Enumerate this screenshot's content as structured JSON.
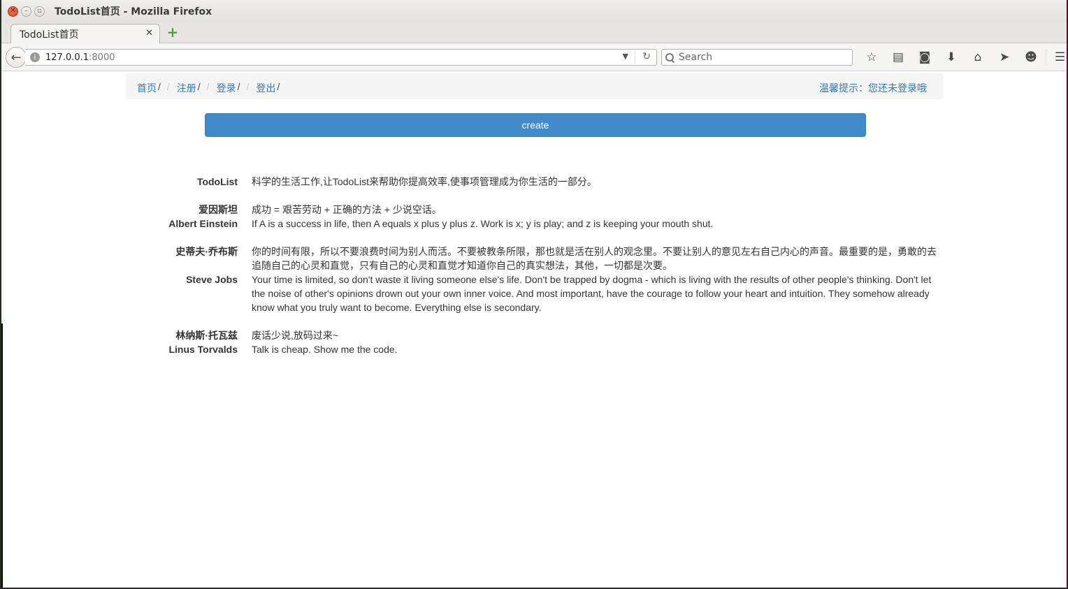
{
  "window": {
    "title": "TodoList首页 - Mozilla Firefox"
  },
  "tab": {
    "title": "TodoList首页",
    "close_glyph": "✕",
    "new_tab_glyph": "+"
  },
  "toolbar": {
    "url_host": "127.0.0.1",
    "url_port": ":8000",
    "search_placeholder": "Search",
    "icons": [
      "bookmark-star-icon",
      "reading-list-icon",
      "pocket-icon",
      "download-icon",
      "home-icon",
      "share-icon",
      "chat-icon",
      "hamburger-menu-icon"
    ]
  },
  "breadcrumb": {
    "items": [
      {
        "label": "首页",
        "slash": "/"
      },
      {
        "label": "注册",
        "slash": "/"
      },
      {
        "label": "登录",
        "slash": "/"
      },
      {
        "label": "登出",
        "slash": "/"
      }
    ],
    "separator": "/",
    "hint": "温馨提示：您还未登录哦"
  },
  "create_button": {
    "label": "create"
  },
  "quotes": [
    {
      "name_cn": "TodoList",
      "name_en": "",
      "text_cn": "科学的生活工作,让TodoList来帮助你提高效率,使事项管理成为你生活的一部分。",
      "text_en": ""
    },
    {
      "name_cn": "爱因斯坦",
      "name_en": "Albert Einstein",
      "text_cn": "成功 = 艰苦劳动 + 正确的方法 + 少说空话。",
      "text_en": "If A is a success in life, then A equals x plus y plus z. Work is x; y is play; and z is keeping your mouth shut."
    },
    {
      "name_cn": "史蒂夫·乔布斯",
      "name_en": "Steve Jobs",
      "text_cn": "你的时间有限，所以不要浪费时间为别人而活。不要被教条所限，那也就是活在别人的观念里。不要让别人的意见左右自己内心的声音。最重要的是，勇敢的去追随自己的心灵和直觉，只有自己的心灵和直觉才知道你自己的真实想法，其他，一切都是次要。",
      "text_en": "Your time is limited, so don't waste it living someone else's life. Don't be trapped by dogma - which is living with the results of other people's thinking. Don't let the noise of other's opinions drown out your own inner voice. And most important, have the courage to follow your heart and intuition. They somehow already know what you truly want to become. Everything else is secondary."
    },
    {
      "name_cn": "林纳斯·托瓦兹",
      "name_en": "Linus Torvalds",
      "text_cn": "废话少说,放码过来~",
      "text_en": "Talk is cheap. Show me the code."
    }
  ],
  "colors": {
    "link": "#337ab7",
    "create_button": "#428bca",
    "breadcrumb_bg": "#f5f5f5"
  }
}
